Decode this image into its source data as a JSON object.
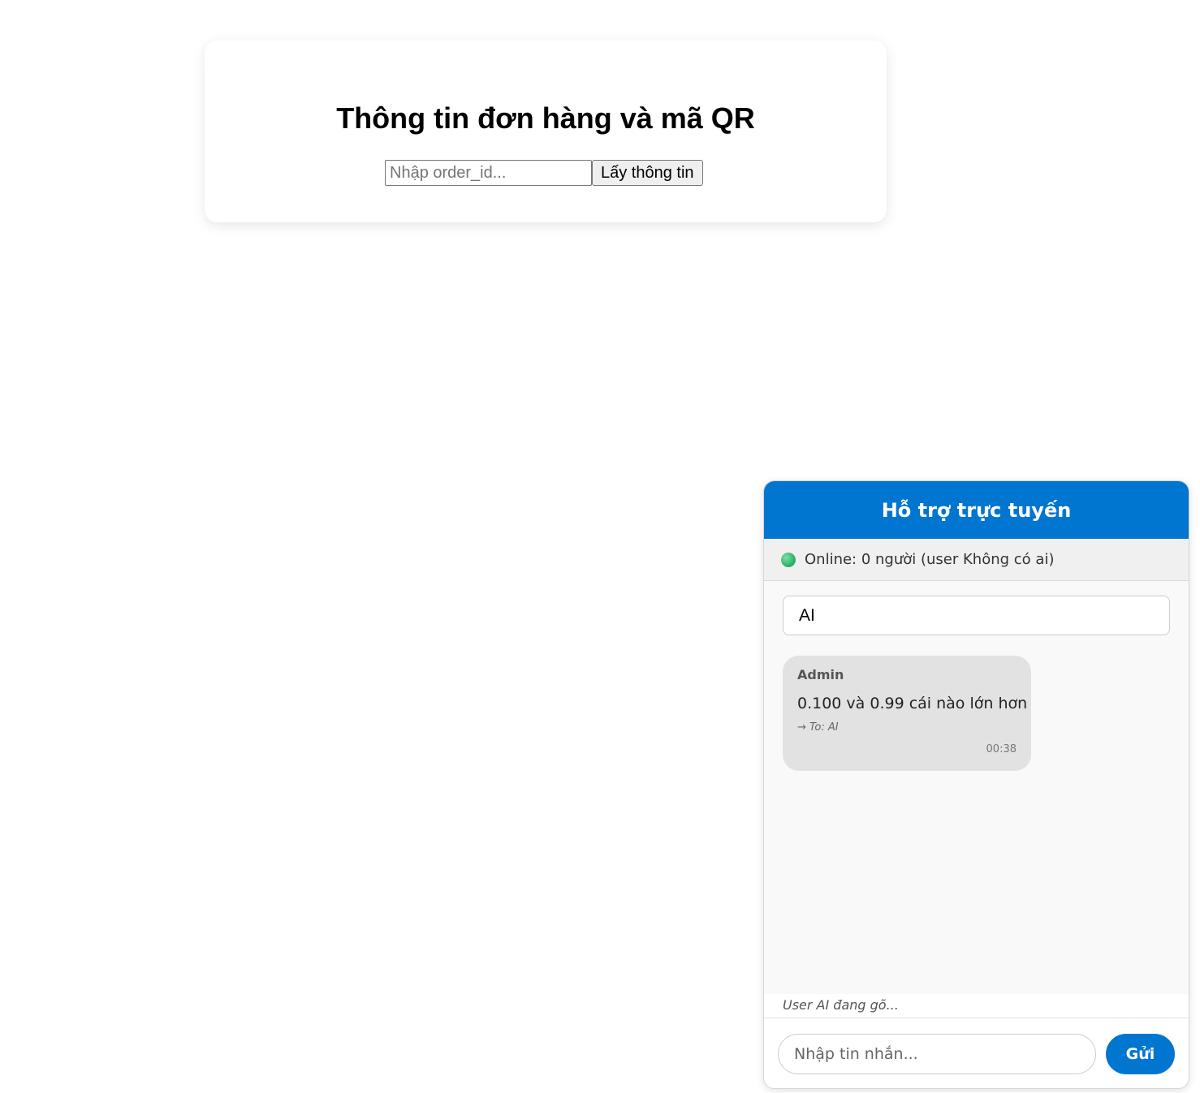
{
  "order": {
    "title": "Thông tin đơn hàng và mã QR",
    "input_placeholder": "Nhập order_id...",
    "input_value": "",
    "button_label": "Lấy thông tin"
  },
  "chat": {
    "header_title": "Hỗ trợ trực tuyến",
    "status_text": "Online: 0 người (user Không có ai)",
    "status_color": "#2fb36a",
    "recipient_selected": "AI",
    "messages": [
      {
        "sender": "Admin",
        "text": "0.100 và 0.99 cái nào lớn hơn",
        "to": "→ To: AI",
        "time": "00:38"
      }
    ],
    "typing_text": "User AI đang gõ...",
    "input_placeholder": "Nhập tin nhắn...",
    "send_label": "Gửi",
    "accent_color": "#0076d1"
  }
}
